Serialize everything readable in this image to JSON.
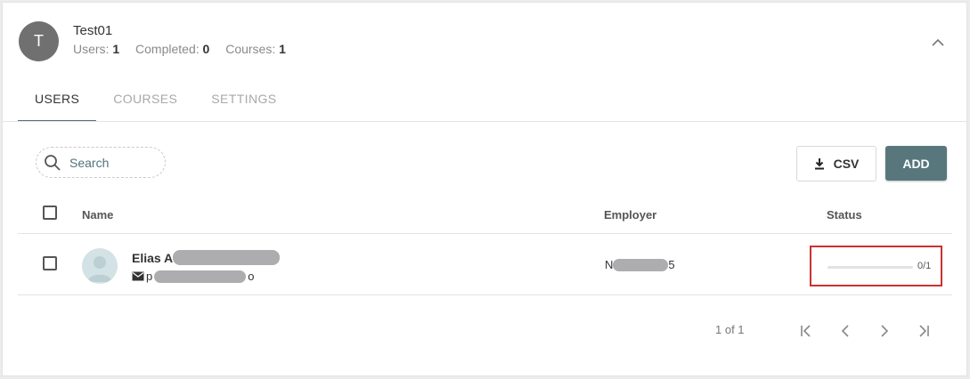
{
  "group": {
    "avatar_letter": "T",
    "title": "Test01",
    "stats": [
      {
        "label": "Users:",
        "value": "1"
      },
      {
        "label": "Completed:",
        "value": "0"
      },
      {
        "label": "Courses:",
        "value": "1"
      }
    ]
  },
  "tabs": [
    {
      "label": "USERS",
      "active": true
    },
    {
      "label": "COURSES",
      "active": false
    },
    {
      "label": "SETTINGS",
      "active": false
    }
  ],
  "toolbar": {
    "search_placeholder": "Search",
    "csv_label": "CSV",
    "add_label": "ADD"
  },
  "table": {
    "columns": {
      "name": "Name",
      "employer": "Employer",
      "status": "Status"
    },
    "rows": [
      {
        "name_visible": "Elias A",
        "email_start": "p",
        "email_end": "o",
        "employer_start": "N",
        "employer_end": "5",
        "progress_label": "0/1",
        "progress_fraction": 0
      }
    ]
  },
  "pagination": {
    "text": "1 of 1"
  },
  "colors": {
    "accent": "#57777d",
    "highlight_border": "#c8332f",
    "avatar_bg": "#707070"
  },
  "icons": [
    "chevron-up-icon",
    "search-icon",
    "download-icon",
    "email-icon",
    "user-avatar-icon",
    "first-page-icon",
    "prev-page-icon",
    "next-page-icon",
    "last-page-icon"
  ]
}
